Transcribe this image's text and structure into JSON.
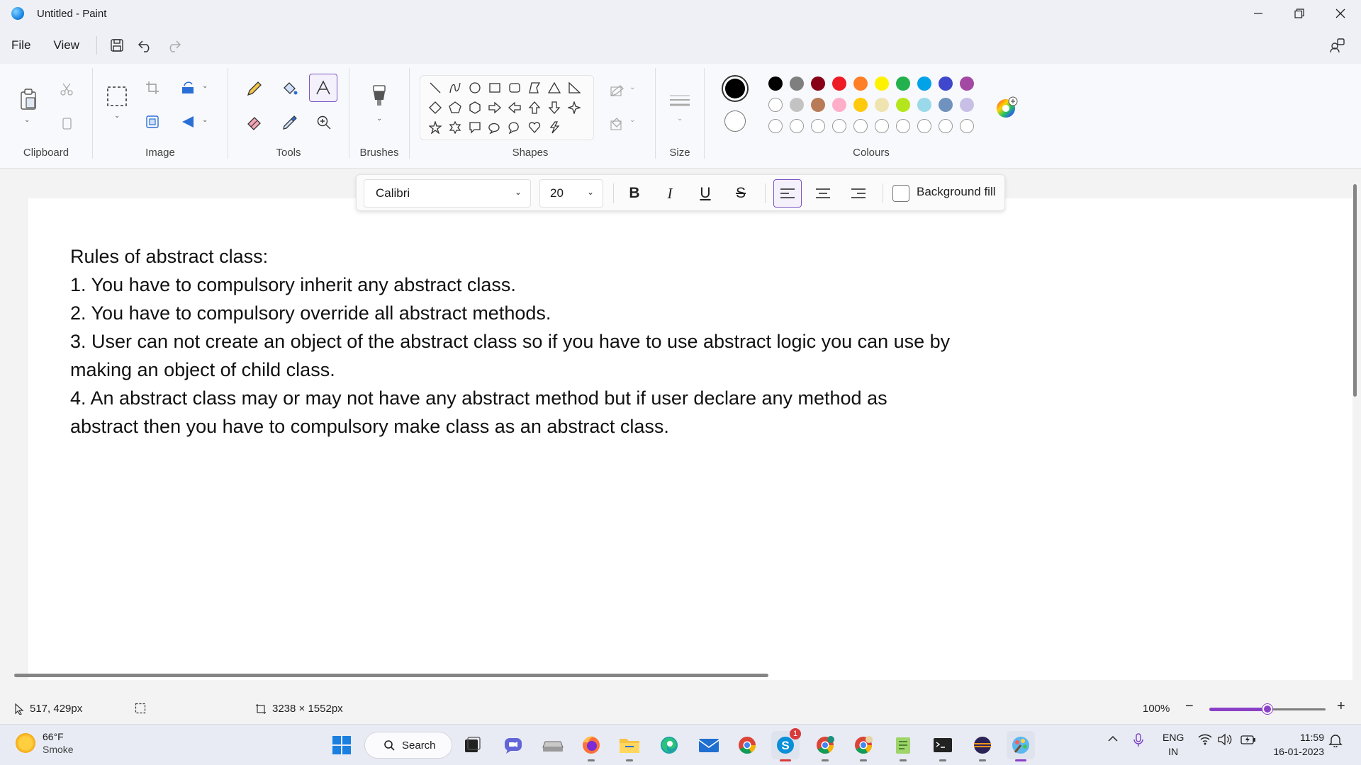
{
  "window": {
    "title": "Untitled - Paint",
    "controls": {
      "minimize": "—",
      "restore": "❐",
      "close": "✕"
    }
  },
  "menu": {
    "file": "File",
    "view": "View"
  },
  "ribbon": {
    "groups": {
      "clipboard": "Clipboard",
      "image": "Image",
      "tools": "Tools",
      "brushes": "Brushes",
      "shapes": "Shapes",
      "size": "Size",
      "colours": "Colours"
    },
    "colour_palette_row1": [
      "#000000",
      "#7f7f7f",
      "#880015",
      "#ed1c24",
      "#ff7f27",
      "#fff200",
      "#22b14c",
      "#00a2e8",
      "#3f48cc",
      "#a349a4"
    ],
    "colour_palette_row2": [
      "#ffffff",
      "#c3c3c3",
      "#b97a57",
      "#ffaec9",
      "#ffc90e",
      "#efe4b0",
      "#b5e61d",
      "#99d9ea",
      "#7092be",
      "#c8bfe7"
    ],
    "primary_colour": "#000000",
    "secondary_colour": "#ffffff"
  },
  "text_toolbar": {
    "font": "Calibri",
    "size": "20",
    "bold_glyph": "B",
    "italic_glyph": "I",
    "underline_glyph": "U",
    "strike_glyph": "S",
    "background_fill_label": "Background fill",
    "background_fill_checked": false,
    "alignment": "left"
  },
  "canvas": {
    "lines": [
      "Rules of abstract class:",
      "1. You have to compulsory inherit any abstract class.",
      "2. You have to compulsory override all abstract methods.",
      "3. User can not create an object of the abstract class so if you have to use abstract logic you can use by",
      "making an object of child class.",
      "4. An abstract class may or may not have any abstract method but if user declare any method as",
      "abstract then you have to compulsory make class as an abstract class."
    ]
  },
  "status": {
    "cursor_position": "517, 429px",
    "canvas_size": "3238 × 1552px",
    "zoom": "100%",
    "zoom_level": 0.5
  },
  "taskbar": {
    "weather_temp": "66°F",
    "weather_desc": "Smoke",
    "search_label": "Search",
    "skype_badge": "1",
    "language_line1": "ENG",
    "language_line2": "IN",
    "time": "11:59",
    "date": "16-01-2023"
  }
}
